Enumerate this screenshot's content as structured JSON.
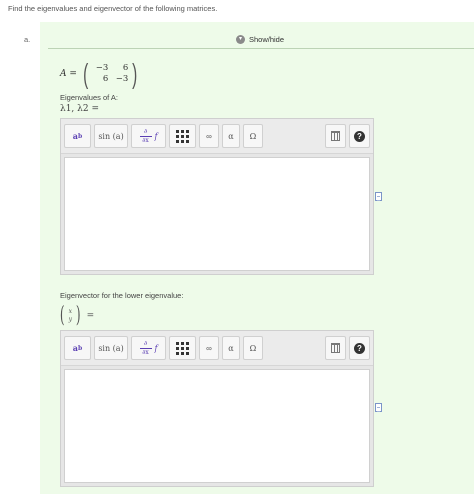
{
  "question": "Find the eigenvalues and eigenvector of the following matrices.",
  "part_label": "a.",
  "show_hide_label": "Show/hide",
  "matrix": {
    "lhs": "A =",
    "cells": [
      "−3",
      "6",
      "6",
      "−3"
    ]
  },
  "eigenvalues_label": "Eigenvalues of A:",
  "eigenvalues_math": "λ1, λ2 =",
  "eigenvector_label": "Eigenvector for the lower eigenvalue:",
  "vector_entries": [
    "x",
    "y"
  ],
  "vector_equals": "=",
  "toolbar": {
    "superscript_base": "a",
    "superscript_exp": "b",
    "sin_label": "sin (a)",
    "deriv_top": "∂",
    "deriv_bottom": "∂x",
    "deriv_f": "f",
    "infinity_label": "∞",
    "alpha_label": "α",
    "omega_label": "Ω",
    "help_label": "?"
  },
  "icons": [
    "chevron-icon",
    "matrix-icon",
    "trash-icon",
    "help-icon",
    "document-icon"
  ]
}
